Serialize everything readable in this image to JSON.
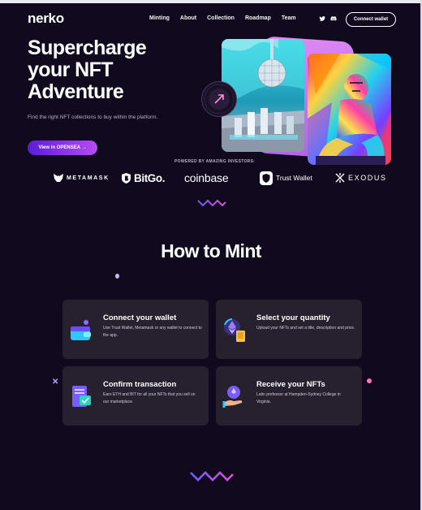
{
  "brand": {
    "logo": "nerko"
  },
  "nav": {
    "items": [
      "Minting",
      "About",
      "Collection",
      "Roadmap",
      "Team"
    ]
  },
  "header": {
    "connect_label": "Connect wallet",
    "social_icons": [
      "twitter-icon",
      "discord-icon"
    ]
  },
  "hero": {
    "title_lines": [
      "Supercharge",
      "your NFT",
      "Adventure"
    ],
    "subtitle": "Find the right NFT collections to buy within the platform.",
    "cta_label": "View in OPENSEA →",
    "badge_text": "VIEW IN OPENSEA • VIEW IN OPENSEA •"
  },
  "investors": {
    "label": "POWERED BY AMAZING INVESTORS:",
    "partners": [
      {
        "name": "METAMASK",
        "icon": "fox-icon"
      },
      {
        "name": "BitGo.",
        "icon": "shield-b-icon"
      },
      {
        "name": "coinbase",
        "icon": ""
      },
      {
        "name": "Trust Wallet",
        "icon": "trust-shield-icon"
      },
      {
        "name": "EXODUS",
        "icon": "exodus-x-icon"
      }
    ]
  },
  "how_to_mint": {
    "title": "How to Mint",
    "steps": [
      {
        "title": "Connect your wallet",
        "description": "Use Trust Wallet, Metamask or any wallet to connect to the app.",
        "icon": "wallet-icon"
      },
      {
        "title": "Select your quantity",
        "description": "Upload your NFTs and set a title, description and price.",
        "icon": "select-nft-icon"
      },
      {
        "title": "Confirm transaction",
        "description": "Earn ETH and BIT for all your NFTs that you sell on our marketplace.",
        "icon": "receipt-icon"
      },
      {
        "title": "Receive your NFTs",
        "description": "Latin professor at Hampden-Sydney College in Virginia.",
        "icon": "hand-coin-icon"
      }
    ]
  },
  "colors": {
    "background": "#110a1f",
    "card": "#27212f",
    "accent_start": "#5b1dd6",
    "accent_end": "#b64cf0",
    "wave_start": "#6a5cff",
    "wave_end": "#e04fd0"
  }
}
